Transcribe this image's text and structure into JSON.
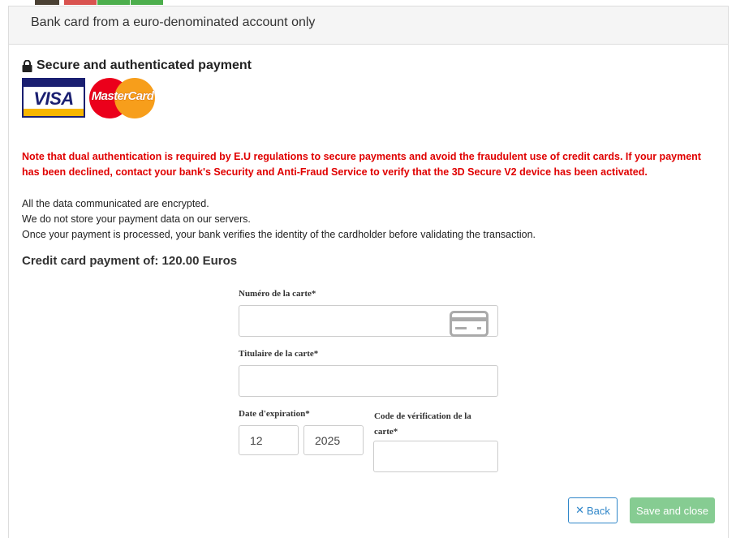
{
  "header": {
    "title": "Bank card from a euro-denominated account only"
  },
  "secure": {
    "title": "Secure and authenticated payment",
    "icon": "lock-icon"
  },
  "logos": {
    "visa": "VISA",
    "mastercard": "MasterCard"
  },
  "notice": "Note that dual authentication is required by E.U regulations to secure payments and avoid the fraudulent use of credit cards. If your payment has been declined, contact your bank's Security and Anti-Fraud Service to verify that the 3D Secure V2 device has been activated.",
  "info": {
    "line1": "All the data communicated are encrypted.",
    "line2": "We do not store your payment data on our servers.",
    "line3": "Once your payment is processed, your bank verifies the identity of the cardholder before validating the transaction."
  },
  "amount": "Credit card payment of: 120.00 Euros",
  "form": {
    "card_number_label": "Numéro de la carte*",
    "card_number_value": "",
    "holder_label": "Titulaire de la carte*",
    "holder_value": "",
    "expiry_label": "Date d'expiration*",
    "expiry_month": "12",
    "expiry_year": "2025",
    "cvv_label_line1": "Code de vérification de la",
    "cvv_label_line2": "carte*",
    "cvv_value": ""
  },
  "buttons": {
    "back": "Back",
    "save": "Save and close"
  },
  "colors": {
    "notice": "#e00000",
    "back_button": "#2f86c9",
    "save_button": "#86cc92"
  }
}
